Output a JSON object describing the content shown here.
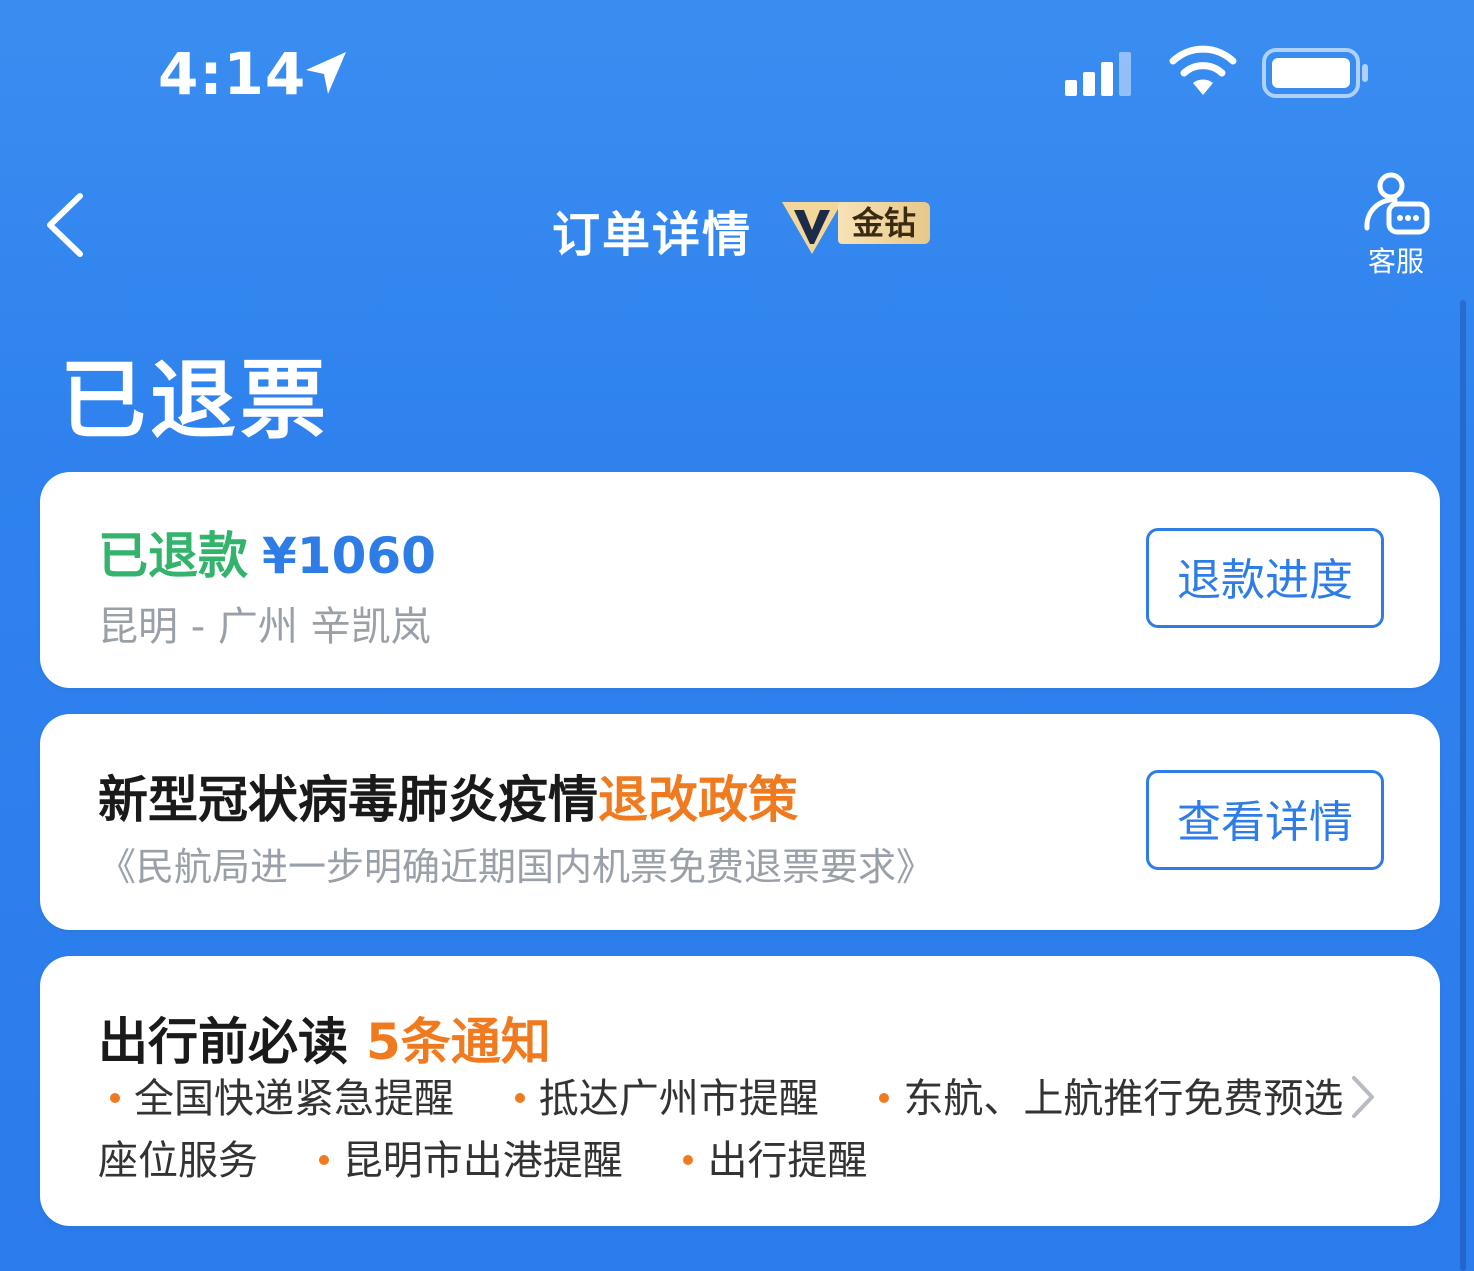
{
  "status_bar": {
    "time": "4:14"
  },
  "nav": {
    "title": "订单详情",
    "vip_label": "金钻",
    "customer_service_label": "客服"
  },
  "order_status": "已退票",
  "refund_card": {
    "status_label": "已退款",
    "amount": "¥1060",
    "route": "昆明 - 广州  辛凯岚",
    "button_label": "退款进度"
  },
  "policy_card": {
    "title_main": "新型冠状病毒肺炎疫情",
    "title_highlight": "退改政策",
    "subtitle": "《民航局进一步明确近期国内机票免费退票要求》",
    "button_label": "查看详情"
  },
  "notice_card": {
    "title": "出行前必读",
    "count_label": "5条通知",
    "items": [
      "全国快递紧急提醒",
      "抵达广州市提醒",
      "东航、上航推行免费预选座位服务",
      "昆明市出港提醒",
      "出行提醒"
    ]
  },
  "colors": {
    "background": "#2f82ee",
    "refund_green": "#33b36b",
    "accent_blue": "#2e7de6",
    "highlight_orange": "#f07a1f"
  }
}
